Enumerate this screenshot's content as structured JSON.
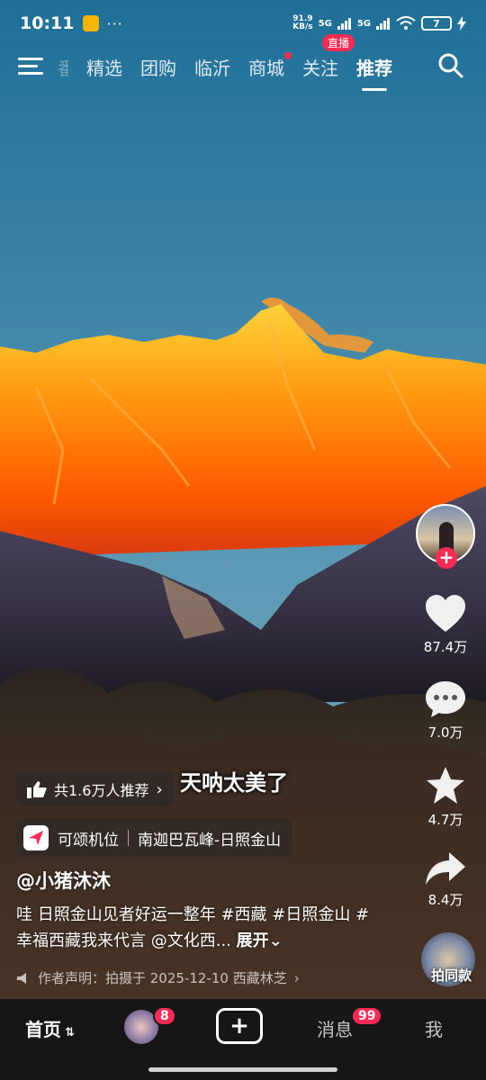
{
  "status_bar": {
    "time": "10:11",
    "more": "···",
    "speed_top": "91.9",
    "speed_unit": "KB/s",
    "signal1": "5G",
    "signal2": "5G",
    "battery": "7"
  },
  "top_nav": {
    "faded_tab": "番",
    "tabs": [
      "精选",
      "团购",
      "临沂",
      "商城",
      "关注",
      "推荐"
    ],
    "live_badge": "直播",
    "active_tab": "推荐"
  },
  "video": {
    "overlay_caption": "天呐太美了",
    "recommend_text": "共1.6万人推荐",
    "location_prefix": "可颂机位",
    "location_name": "南迦巴瓦峰-日照金山",
    "author": "@小猪沐沐",
    "description": "哇 日照金山见者好运一整年 #西藏 #日照金山 #幸福西藏我来代言 @文化西...",
    "expand_label": "展开",
    "declaration": "作者声明：拍摄于 2025-12-10 西藏林芝"
  },
  "actions": {
    "likes": "87.4万",
    "comments": "7.0万",
    "favorites": "4.7万",
    "shares": "8.4万",
    "same_style": "拍同款"
  },
  "bottom_bar": {
    "home": "首页",
    "friends_badge": "8",
    "messages": "消息",
    "messages_badge": "99",
    "me": "我"
  },
  "colors": {
    "accent": "#fe2c55",
    "sky_top": "#1f6f98",
    "sky_bottom": "#6a9fb8",
    "mountain": "#ff7a00"
  }
}
